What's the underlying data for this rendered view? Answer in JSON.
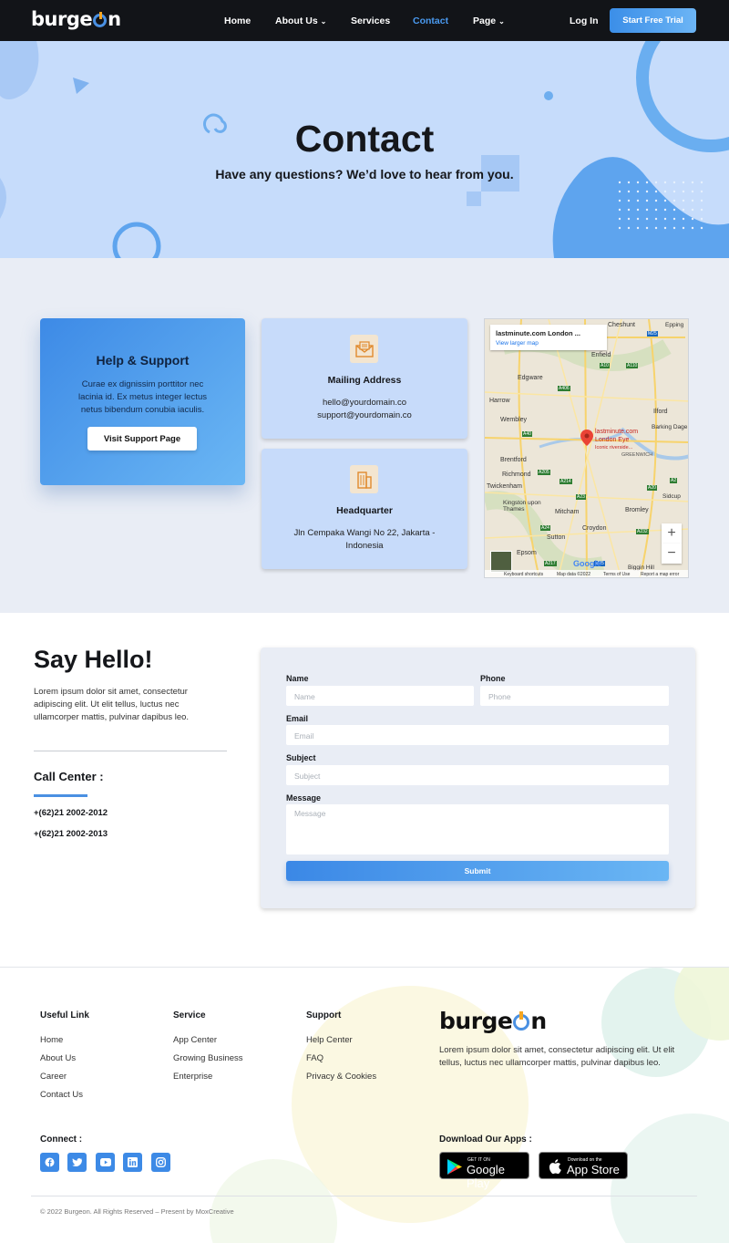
{
  "nav": {
    "logo_text": "burgeon",
    "items": [
      {
        "label": "Home"
      },
      {
        "label": "About Us"
      },
      {
        "label": "Services"
      },
      {
        "label": "Contact"
      },
      {
        "label": "Page"
      }
    ],
    "login_label": "Log In",
    "trial_label": "Start Free Trial",
    "active_color": "#4a9af0"
  },
  "hero": {
    "title": "Contact",
    "subtitle": "Have any questions? We’d love to hear from you."
  },
  "help": {
    "title": "Help & Support",
    "text": "Curae ex dignissim porttitor nec lacinia id. Ex metus integer lectus netus bibendum conubia iaculis.",
    "button_label": "Visit Support Page"
  },
  "mailing": {
    "icon": "envelope-icon",
    "title": "Mailing Address",
    "line1": "hello@yourdomain.co",
    "line2": "support@yourdomain.co"
  },
  "headquarter": {
    "icon": "building-icon",
    "title": "Headquarter",
    "address": "Jln Cempaka Wangi No 22, Jakarta - Indonesia"
  },
  "map": {
    "place_title": "lastminute.com London ...",
    "view_larger": "View larger map",
    "pin_label1": "lastminute.com",
    "pin_label2": "London Eye",
    "pin_label3": "Iconic riverside...",
    "zoom_in": "+",
    "zoom_out": "−",
    "places": [
      "Cheshunt",
      "Epping",
      "Enfield",
      "Edgware",
      "Harrow",
      "Wembley",
      "Ilford",
      "Barking Dage",
      "Brentford",
      "Richmond",
      "Twickenham",
      "Kingston upon Thames",
      "Mitcham",
      "Croydon",
      "Bromley",
      "Sidcup",
      "Epsom",
      "Sutton",
      "Biggin Hill",
      "GREENWICH"
    ],
    "roads": [
      "M25",
      "A10",
      "A406",
      "A40",
      "A205",
      "A214",
      "A23",
      "A20",
      "A2",
      "A232",
      "A24",
      "A217",
      "M25",
      "A110"
    ],
    "footer": {
      "keyboard": "Keyboard shortcuts",
      "map_data": "Map data ©2022",
      "terms": "Terms of Use",
      "report": "Report a map error",
      "brand": "Google"
    }
  },
  "say_hello": {
    "title": "Say Hello!",
    "text": "Lorem ipsum dolor sit amet, consectetur adipiscing elit. Ut elit tellus, luctus nec ullamcorper mattis, pulvinar dapibus leo.",
    "call_center_title": "Call Center :",
    "phone1": "+(62)21 2002-2012",
    "phone2": "+(62)21 2002-2013"
  },
  "form": {
    "name_label": "Name",
    "name_placeholder": "Name",
    "phone_label": "Phone",
    "phone_placeholder": "Phone",
    "email_label": "Email",
    "email_placeholder": "Email",
    "subject_label": "Subject",
    "subject_placeholder": "Subject",
    "message_label": "Message",
    "message_placeholder": "Message",
    "submit_label": "Submit"
  },
  "footer": {
    "useful": {
      "title": "Useful Link",
      "links": [
        "Home",
        "About Us",
        "Career",
        "Contact Us"
      ]
    },
    "service": {
      "title": "Service",
      "links": [
        "App Center",
        "Growing Business",
        "Enterprise"
      ]
    },
    "support": {
      "title": "Support",
      "links": [
        "Help Center",
        "FAQ",
        "Privacy & Cookies"
      ]
    },
    "logo_text": "burgeon",
    "about": "Lorem ipsum dolor sit amet, consectetur adipiscing elit. Ut elit tellus, luctus nec ullamcorper mattis, pulvinar dapibus leo.",
    "connect_title": "Connect :",
    "social_icons": [
      "facebook-icon",
      "twitter-icon",
      "youtube-icon",
      "linkedin-icon",
      "instagram-icon"
    ],
    "apps_title": "Download Our Apps :",
    "google_small": "GET IT ON",
    "google_big": "Google Play",
    "apple_small": "Download on the",
    "apple_big": "App Store",
    "copyright": "© 2022 Burgeon. All Rights Reserved – Present by MoxCreative"
  }
}
